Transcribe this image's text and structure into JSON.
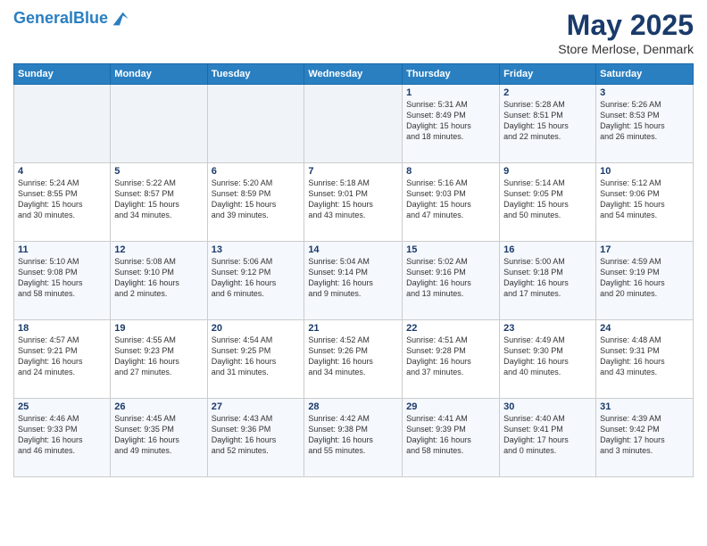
{
  "header": {
    "logo_line1": "General",
    "logo_line2": "Blue",
    "title": "May 2025",
    "subtitle": "Store Merlose, Denmark"
  },
  "weekdays": [
    "Sunday",
    "Monday",
    "Tuesday",
    "Wednesday",
    "Thursday",
    "Friday",
    "Saturday"
  ],
  "weeks": [
    [
      {
        "num": "",
        "info": ""
      },
      {
        "num": "",
        "info": ""
      },
      {
        "num": "",
        "info": ""
      },
      {
        "num": "",
        "info": ""
      },
      {
        "num": "1",
        "info": "Sunrise: 5:31 AM\nSunset: 8:49 PM\nDaylight: 15 hours\nand 18 minutes."
      },
      {
        "num": "2",
        "info": "Sunrise: 5:28 AM\nSunset: 8:51 PM\nDaylight: 15 hours\nand 22 minutes."
      },
      {
        "num": "3",
        "info": "Sunrise: 5:26 AM\nSunset: 8:53 PM\nDaylight: 15 hours\nand 26 minutes."
      }
    ],
    [
      {
        "num": "4",
        "info": "Sunrise: 5:24 AM\nSunset: 8:55 PM\nDaylight: 15 hours\nand 30 minutes."
      },
      {
        "num": "5",
        "info": "Sunrise: 5:22 AM\nSunset: 8:57 PM\nDaylight: 15 hours\nand 34 minutes."
      },
      {
        "num": "6",
        "info": "Sunrise: 5:20 AM\nSunset: 8:59 PM\nDaylight: 15 hours\nand 39 minutes."
      },
      {
        "num": "7",
        "info": "Sunrise: 5:18 AM\nSunset: 9:01 PM\nDaylight: 15 hours\nand 43 minutes."
      },
      {
        "num": "8",
        "info": "Sunrise: 5:16 AM\nSunset: 9:03 PM\nDaylight: 15 hours\nand 47 minutes."
      },
      {
        "num": "9",
        "info": "Sunrise: 5:14 AM\nSunset: 9:05 PM\nDaylight: 15 hours\nand 50 minutes."
      },
      {
        "num": "10",
        "info": "Sunrise: 5:12 AM\nSunset: 9:06 PM\nDaylight: 15 hours\nand 54 minutes."
      }
    ],
    [
      {
        "num": "11",
        "info": "Sunrise: 5:10 AM\nSunset: 9:08 PM\nDaylight: 15 hours\nand 58 minutes."
      },
      {
        "num": "12",
        "info": "Sunrise: 5:08 AM\nSunset: 9:10 PM\nDaylight: 16 hours\nand 2 minutes."
      },
      {
        "num": "13",
        "info": "Sunrise: 5:06 AM\nSunset: 9:12 PM\nDaylight: 16 hours\nand 6 minutes."
      },
      {
        "num": "14",
        "info": "Sunrise: 5:04 AM\nSunset: 9:14 PM\nDaylight: 16 hours\nand 9 minutes."
      },
      {
        "num": "15",
        "info": "Sunrise: 5:02 AM\nSunset: 9:16 PM\nDaylight: 16 hours\nand 13 minutes."
      },
      {
        "num": "16",
        "info": "Sunrise: 5:00 AM\nSunset: 9:18 PM\nDaylight: 16 hours\nand 17 minutes."
      },
      {
        "num": "17",
        "info": "Sunrise: 4:59 AM\nSunset: 9:19 PM\nDaylight: 16 hours\nand 20 minutes."
      }
    ],
    [
      {
        "num": "18",
        "info": "Sunrise: 4:57 AM\nSunset: 9:21 PM\nDaylight: 16 hours\nand 24 minutes."
      },
      {
        "num": "19",
        "info": "Sunrise: 4:55 AM\nSunset: 9:23 PM\nDaylight: 16 hours\nand 27 minutes."
      },
      {
        "num": "20",
        "info": "Sunrise: 4:54 AM\nSunset: 9:25 PM\nDaylight: 16 hours\nand 31 minutes."
      },
      {
        "num": "21",
        "info": "Sunrise: 4:52 AM\nSunset: 9:26 PM\nDaylight: 16 hours\nand 34 minutes."
      },
      {
        "num": "22",
        "info": "Sunrise: 4:51 AM\nSunset: 9:28 PM\nDaylight: 16 hours\nand 37 minutes."
      },
      {
        "num": "23",
        "info": "Sunrise: 4:49 AM\nSunset: 9:30 PM\nDaylight: 16 hours\nand 40 minutes."
      },
      {
        "num": "24",
        "info": "Sunrise: 4:48 AM\nSunset: 9:31 PM\nDaylight: 16 hours\nand 43 minutes."
      }
    ],
    [
      {
        "num": "25",
        "info": "Sunrise: 4:46 AM\nSunset: 9:33 PM\nDaylight: 16 hours\nand 46 minutes."
      },
      {
        "num": "26",
        "info": "Sunrise: 4:45 AM\nSunset: 9:35 PM\nDaylight: 16 hours\nand 49 minutes."
      },
      {
        "num": "27",
        "info": "Sunrise: 4:43 AM\nSunset: 9:36 PM\nDaylight: 16 hours\nand 52 minutes."
      },
      {
        "num": "28",
        "info": "Sunrise: 4:42 AM\nSunset: 9:38 PM\nDaylight: 16 hours\nand 55 minutes."
      },
      {
        "num": "29",
        "info": "Sunrise: 4:41 AM\nSunset: 9:39 PM\nDaylight: 16 hours\nand 58 minutes."
      },
      {
        "num": "30",
        "info": "Sunrise: 4:40 AM\nSunset: 9:41 PM\nDaylight: 17 hours\nand 0 minutes."
      },
      {
        "num": "31",
        "info": "Sunrise: 4:39 AM\nSunset: 9:42 PM\nDaylight: 17 hours\nand 3 minutes."
      }
    ]
  ]
}
